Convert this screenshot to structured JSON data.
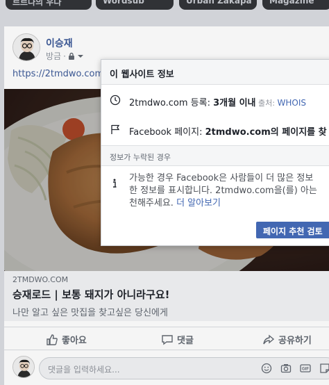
{
  "stories": [
    "르르나의 우다",
    "Wordsub",
    "Urban Zakapa",
    "Magazine"
  ],
  "post": {
    "author": "이승재",
    "timestamp": "방금",
    "audience_icon": "lock-icon",
    "link_text": "https://2tmdwo.com",
    "link_preview": {
      "domain": "2TMDWO.COM",
      "title": "승재로드 | 보통 돼지가 아니라구요!",
      "description": "나만 알고 싶은 맛집을 찾고싶은 당신에게"
    },
    "actions": {
      "like": "좋아요",
      "comment": "댓글",
      "share": "공유하기"
    },
    "comment_placeholder": "댓글을 입력하세요..."
  },
  "popover": {
    "title": "이 웹사이트 정보",
    "registered": {
      "domain": "2tmdwo.com 등록: ",
      "value": "3개월 이내",
      "source_label": " 출처: ",
      "source": "WHOIS"
    },
    "facebook_page": {
      "prefix": "Facebook 페이지: ",
      "value": "2tmdwo.com의 페이지를 찾"
    },
    "section_label": "정보가 누락된 경우",
    "description_line1": "가능한 경우 Facebook은 사람들이 더 많은 정보",
    "description_line2": "한 정보를 표시합니다. 2tmdwo.com을(를) 아는",
    "description_line3": "천해주세요. ",
    "learn_more": "더 알아보기",
    "recommend_button": "페이지 추천 검토"
  },
  "colors": {
    "facebook_blue": "#4267b2",
    "link_blue": "#3b5998"
  }
}
